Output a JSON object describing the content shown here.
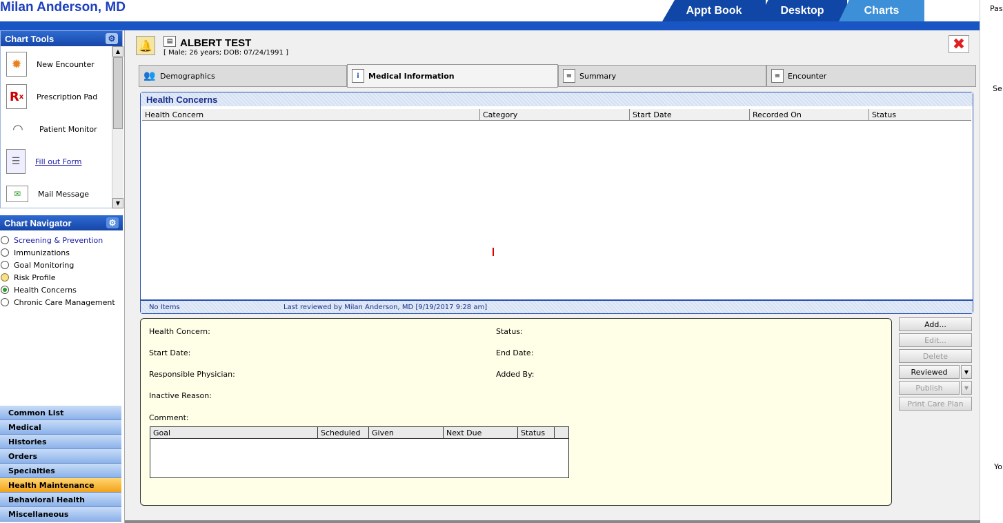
{
  "app": {
    "title": "Milan Anderson, MD"
  },
  "top_tabs": [
    {
      "label": "Appt Book"
    },
    {
      "label": "Desktop"
    },
    {
      "label": "Charts"
    }
  ],
  "right_strip": {
    "text1": "Pas",
    "text2": "Se",
    "text3": "Yo"
  },
  "chart_tools": {
    "title": "Chart Tools",
    "items": [
      {
        "label": "New Encounter",
        "icon": "new-encounter-icon"
      },
      {
        "label": "Prescription Pad",
        "icon": "rx-icon"
      },
      {
        "label": "Patient Monitor",
        "icon": "gauge-icon"
      },
      {
        "label": "Fill out Form",
        "icon": "form-icon"
      },
      {
        "label": "Mail Message",
        "icon": "mail-icon"
      }
    ]
  },
  "chart_navigator": {
    "title": "Chart Navigator",
    "items": [
      {
        "label": "Screening & Prevention",
        "state": "link"
      },
      {
        "label": "Immunizations",
        "state": "empty"
      },
      {
        "label": "Goal Monitoring",
        "state": "empty"
      },
      {
        "label": "Risk Profile",
        "state": "yellow"
      },
      {
        "label": "Health Concerns",
        "state": "selected"
      },
      {
        "label": "Chronic Care Management",
        "state": "empty"
      }
    ]
  },
  "categories": [
    {
      "label": "Common List"
    },
    {
      "label": "Medical"
    },
    {
      "label": "Histories"
    },
    {
      "label": "Orders"
    },
    {
      "label": "Specialties"
    },
    {
      "label": "Health Maintenance",
      "selected": true
    },
    {
      "label": "Behavioral Health"
    },
    {
      "label": "Miscellaneous"
    }
  ],
  "patient": {
    "name": "ALBERT  TEST",
    "info": "[ Male; 26 years; DOB: 07/24/1991 ]"
  },
  "sub_tabs": [
    {
      "label": "Demographics"
    },
    {
      "label": "Medical Information",
      "active": true
    },
    {
      "label": "Summary"
    },
    {
      "label": "Encounter"
    }
  ],
  "health_concerns": {
    "title": "Health Concerns",
    "columns": [
      "Health Concern",
      "Category",
      "Start Date",
      "Recorded On",
      "Status"
    ],
    "rows": [],
    "footer_count": "No Items",
    "footer_reviewed": "Last reviewed by Milan Anderson, MD [9/19/2017 9:28 am]"
  },
  "detail": {
    "health_concern_label": "Health Concern:",
    "status_label": "Status:",
    "start_date_label": "Start Date:",
    "end_date_label": "End Date:",
    "physician_label": "Responsible Physician:",
    "added_by_label": "Added By:",
    "inactive_reason_label": "Inactive Reason:",
    "comment_label": "Comment:",
    "goal_columns": [
      "Goal",
      "Scheduled",
      "Given",
      "Next Due",
      "Status"
    ]
  },
  "actions": {
    "add": "Add...",
    "edit": "Edit...",
    "delete": "Delete",
    "reviewed": "Reviewed",
    "publish": "Publish",
    "print_care_plan": "Print Care Plan"
  }
}
